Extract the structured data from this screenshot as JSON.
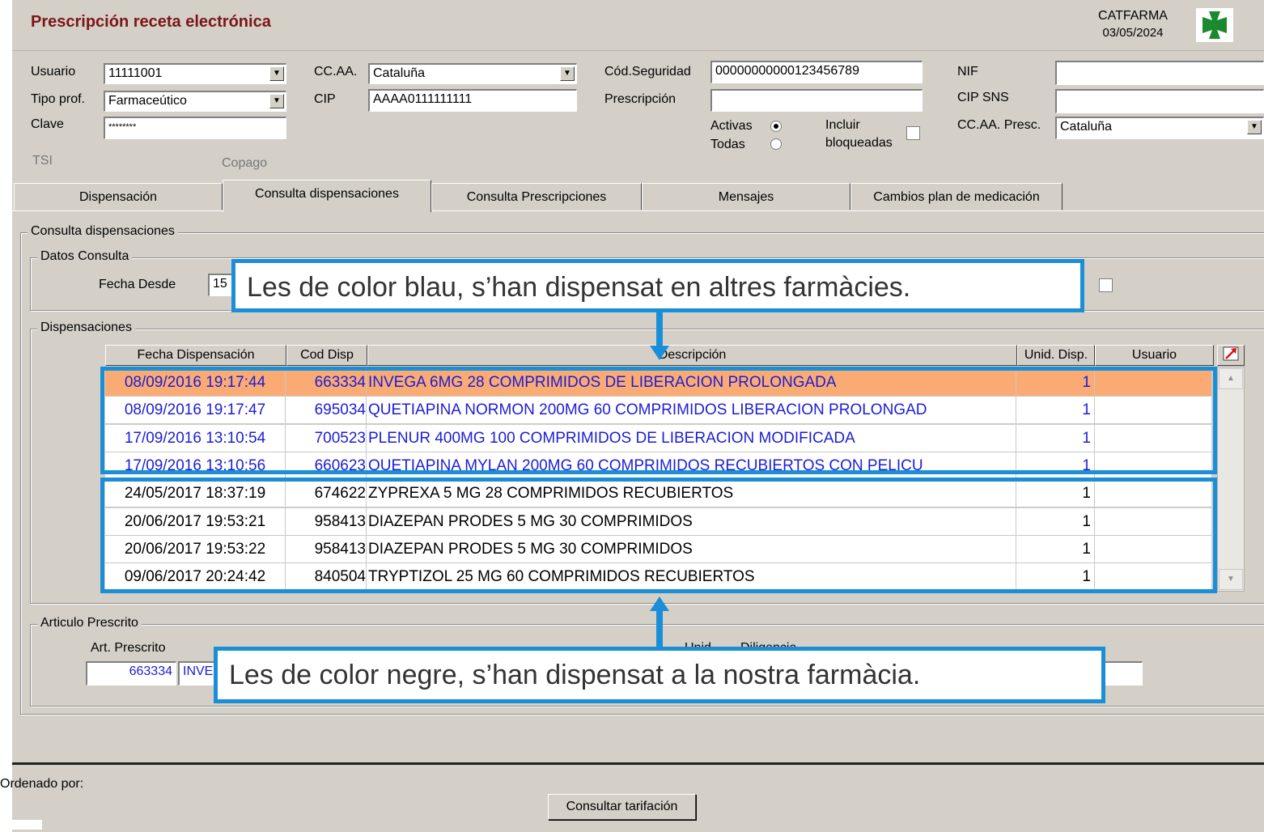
{
  "header": {
    "title": "Prescripción receta electrónica",
    "brand": "CATFARMA",
    "date": "03/05/2024",
    "logo_color": "#1b8a2e"
  },
  "form": {
    "usuario_label": "Usuario",
    "usuario_value": "11111001",
    "tipo_prof_label": "Tipo prof.",
    "tipo_prof_value": "Farmaceútico",
    "clave_label": "Clave",
    "clave_value": "********",
    "ccaa_label": "CC.AA.",
    "ccaa_value": "Cataluña",
    "cip_label": "CIP",
    "cip_value": "AAAA0111111111",
    "cod_seg_label": "Cód.Seguridad",
    "cod_seg_value": "00000000000123456789",
    "prescripcion_label": "Prescripción",
    "prescripcion_value": "",
    "activas_label": "Activas",
    "todas_label": "Todas",
    "incluir_label_1": "Incluir",
    "incluir_label_2": "bloqueadas",
    "nif_label": "NIF",
    "nif_value": "",
    "cip_sns_label": "CIP SNS",
    "cip_sns_value": "",
    "ccaa_presc_label": "CC.AA. Presc.",
    "ccaa_presc_value": "Cataluña",
    "tsi_label": "TSI",
    "copago_label": "Copago"
  },
  "tabs": [
    {
      "label": "Dispensación"
    },
    {
      "label": "Consulta dispensaciones"
    },
    {
      "label": "Consulta Prescripciones"
    },
    {
      "label": "Mensajes"
    },
    {
      "label": "Cambios plan de medicación"
    }
  ],
  "panel": {
    "title": "Consulta dispensaciones",
    "datos_title": "Datos Consulta",
    "fecha_desde_label": "Fecha Desde",
    "fecha_desde_value": "15",
    "dispensaciones_title": "Dispensaciones"
  },
  "grid": {
    "columns": [
      "Fecha Dispensación",
      "Cod Disp",
      "Descripción",
      "Unid. Disp.",
      "Usuario"
    ],
    "rows": [
      {
        "fecha": "08/09/2016 19:17:44",
        "cod": "663334",
        "desc": "INVEGA 6MG 28 COMPRIMIDOS DE LIBERACION PROLONGADA",
        "unid": "1",
        "usuario": ""
      },
      {
        "fecha": "08/09/2016 19:17:47",
        "cod": "695034",
        "desc": "QUETIAPINA NORMON 200MG 60 COMPRIMIDOS LIBERACION PROLONGAD",
        "unid": "1",
        "usuario": ""
      },
      {
        "fecha": "17/09/2016 13:10:54",
        "cod": "700523",
        "desc": "PLENUR 400MG 100 COMPRIMIDOS DE LIBERACION MODIFICADA",
        "unid": "1",
        "usuario": ""
      },
      {
        "fecha": "17/09/2016 13:10:56",
        "cod": "660623",
        "desc": "QUETIAPINA MYLAN 200MG 60 COMPRIMIDOS RECUBIERTOS CON PELICU",
        "unid": "1",
        "usuario": ""
      },
      {
        "fecha": "24/05/2017 18:37:19",
        "cod": "674622",
        "desc": "ZYPREXA 5 MG 28 COMPRIMIDOS RECUBIERTOS",
        "unid": "1",
        "usuario": ""
      },
      {
        "fecha": "20/06/2017 19:53:21",
        "cod": "958413",
        "desc": "DIAZEPAN PRODES 5 MG 30 COMPRIMIDOS",
        "unid": "1",
        "usuario": ""
      },
      {
        "fecha": "20/06/2017 19:53:22",
        "cod": "958413",
        "desc": "DIAZEPAN PRODES 5 MG 30 COMPRIMIDOS",
        "unid": "1",
        "usuario": ""
      },
      {
        "fecha": "09/06/2017 20:24:42",
        "cod": "840504",
        "desc": "TRYPTIZOL 25 MG 60 COMPRIMIDOS RECUBIERTOS",
        "unid": "1",
        "usuario": ""
      }
    ],
    "selected_color": "#f9ab73",
    "other_pharmacy_color": "#1c1cd8"
  },
  "articulo": {
    "group_title": "Articulo Prescrito",
    "label": "Art. Prescrito",
    "cod": "663334",
    "desc": "INVE",
    "unid_label": "Unid.",
    "diligencia_label": "Diligencia"
  },
  "callouts": {
    "top": "Les de color blau, s’han dispensat en altres farmàcies.",
    "bottom": "Les de color negre, s’han dispensat a la nostra farmàcia.",
    "accent": "#1a8fd8"
  },
  "status": {
    "ordenado_label": "Ordenado por:",
    "consultar_button": "Consultar tarifación"
  }
}
